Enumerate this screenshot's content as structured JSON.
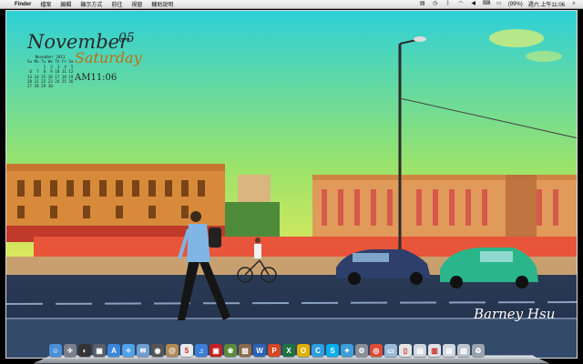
{
  "menubar": {
    "apple_icon": "apple-icon",
    "app_name": "Finder",
    "menus": [
      "檔案",
      "編輯",
      "顯示方式",
      "前往",
      "視窗",
      "輔助說明"
    ],
    "battery": "(99%)",
    "clock": "週六 上午11:06"
  },
  "widget": {
    "month": "November",
    "day": "05",
    "weekday": "Saturday",
    "time": "AM11:06",
    "mini_title": "November 2011",
    "mini_head": "Su Mo Tu We Th Fr Sa",
    "mini_rows": [
      "       1  2  3  4  5",
      " 6  7  8  9 10 11 12",
      "13 14 15 16 17 18 19",
      "20 21 22 23 24 25 26",
      "27 28 29 30"
    ]
  },
  "signature": "Barney Hsu",
  "dock": {
    "items": [
      {
        "name": "finder-icon",
        "color": "#4a90d9",
        "glyph": "☺"
      },
      {
        "name": "launchpad-icon",
        "color": "#7b7f88",
        "glyph": "✈"
      },
      {
        "name": "dashboard-icon",
        "color": "#333333",
        "glyph": "◐"
      },
      {
        "name": "mission-control-icon",
        "color": "#5a5f6a",
        "glyph": "▦"
      },
      {
        "name": "app-store-icon",
        "color": "#3a87e0",
        "glyph": "A"
      },
      {
        "name": "safari-icon",
        "color": "#4fa3e8",
        "glyph": "✧"
      },
      {
        "name": "mail-icon",
        "color": "#6f9fd0",
        "glyph": "✉"
      },
      {
        "name": "facetime-icon",
        "color": "#555555",
        "glyph": "◉"
      },
      {
        "name": "contacts-icon",
        "color": "#b08a55",
        "glyph": "@"
      },
      {
        "name": "calendar-icon",
        "color": "#e8e8e8",
        "glyph": "5"
      },
      {
        "name": "itunes-icon",
        "color": "#3d7fd6",
        "glyph": "♫"
      },
      {
        "name": "photo-booth-icon",
        "color": "#c42222",
        "glyph": "▣"
      },
      {
        "name": "iphoto-icon",
        "color": "#5b8a3a",
        "glyph": "❀"
      },
      {
        "name": "preview-icon",
        "color": "#8a6a4a",
        "glyph": "▧"
      },
      {
        "name": "word-icon",
        "color": "#2c63b8",
        "glyph": "W"
      },
      {
        "name": "powerpoint-icon",
        "color": "#d24726",
        "glyph": "P"
      },
      {
        "name": "excel-icon",
        "color": "#1e7145",
        "glyph": "X"
      },
      {
        "name": "outlook-icon",
        "color": "#e0b000",
        "glyph": "O"
      },
      {
        "name": "messages-icon",
        "color": "#2e9fe0",
        "glyph": "C"
      },
      {
        "name": "skype-icon",
        "color": "#00aff0",
        "glyph": "S"
      },
      {
        "name": "tweetbot-icon",
        "color": "#3c9fd8",
        "glyph": "✦"
      },
      {
        "name": "system-preferences-icon",
        "color": "#8a8f98",
        "glyph": "⚙"
      },
      {
        "name": "chrome-icon",
        "color": "#dd4b39",
        "glyph": "◎"
      },
      {
        "name": "folder-icon",
        "color": "#9ab8d8",
        "glyph": "▭"
      },
      {
        "name": "documents-icon",
        "color": "#e4e4e4",
        "glyph": "▯"
      },
      {
        "name": "downloads-icon",
        "color": "#cfd6de",
        "glyph": "▤"
      },
      {
        "name": "stack-icon",
        "color": "#dfe3e8",
        "glyph": "▥"
      },
      {
        "name": "stack-2-icon",
        "color": "#d0d6dd",
        "glyph": "▤"
      },
      {
        "name": "image-stack-icon",
        "color": "#b9c4cf",
        "glyph": "▨"
      },
      {
        "name": "trash-icon",
        "color": "#9aa3ad",
        "glyph": "♻"
      }
    ]
  }
}
